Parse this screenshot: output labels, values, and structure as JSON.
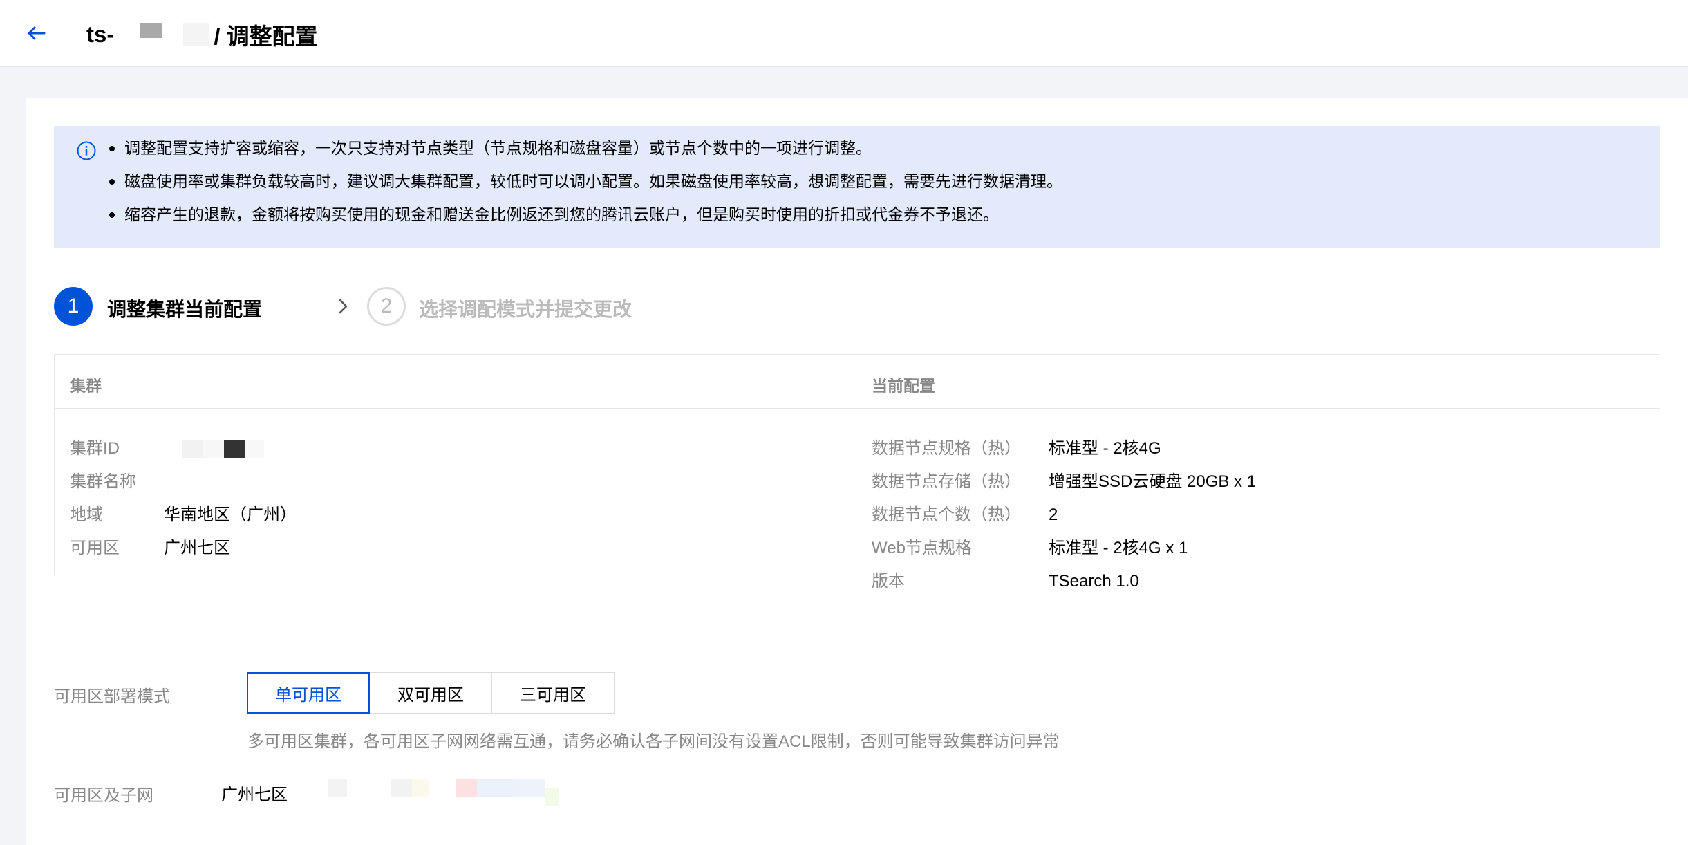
{
  "header": {
    "title_prefix": "ts-",
    "title_suffix": "/ 调整配置"
  },
  "notice": {
    "lines": [
      "调整配置支持扩容或缩容，一次只支持对节点类型（节点规格和磁盘容量）或节点个数中的一项进行调整。",
      "磁盘使用率或集群负载较高时，建议调大集群配置，较低时可以调小配置。如果磁盘使用率较高，想调整配置，需要先进行数据清理。",
      "缩容产生的退款，金额将按购买使用的现金和赠送金比例返还到您的腾讯云账户，但是购买时使用的折扣或代金券不予退还。"
    ]
  },
  "steps": [
    {
      "number": "1",
      "label": "调整集群当前配置"
    },
    {
      "number": "2",
      "label": "选择调配模式并提交更改"
    }
  ],
  "cluster": {
    "header": "集群",
    "rows": [
      {
        "label": "集群ID",
        "value": ""
      },
      {
        "label": "集群名称",
        "value": ""
      },
      {
        "label": "地域",
        "value": "华南地区（广州）"
      },
      {
        "label": "可用区",
        "value": "广州七区"
      }
    ]
  },
  "current_config": {
    "header": "当前配置",
    "rows": [
      {
        "label": "数据节点规格（热）",
        "value": "标准型 - 2核4G"
      },
      {
        "label": "数据节点存储（热）",
        "value": "增强型SSD云硬盘 20GB x 1"
      },
      {
        "label": "数据节点个数（热）",
        "value": "2"
      },
      {
        "label": "Web节点规格",
        "value": "标准型 - 2核4G x 1"
      },
      {
        "label": "版本",
        "value": "TSearch 1.0"
      }
    ]
  },
  "form": {
    "deploy_mode_label": "可用区部署模式",
    "deploy_modes": [
      "单可用区",
      "双可用区",
      "三可用区"
    ],
    "selected_mode": "单可用区",
    "deploy_hint": "多可用区集群，各可用区子网网络需互通，请务必确认各子网间没有设置ACL限制，否则可能导致集群访问异常",
    "zone_subnet_label": "可用区及子网",
    "zone_value": "广州七区"
  },
  "colors": {
    "primary": "#0052d9",
    "notice_bg": "#e2eafc",
    "muted_text": "#888888"
  },
  "icons": [
    "arrow-left-icon",
    "info-circle-icon",
    "chevron-right-icon"
  ]
}
